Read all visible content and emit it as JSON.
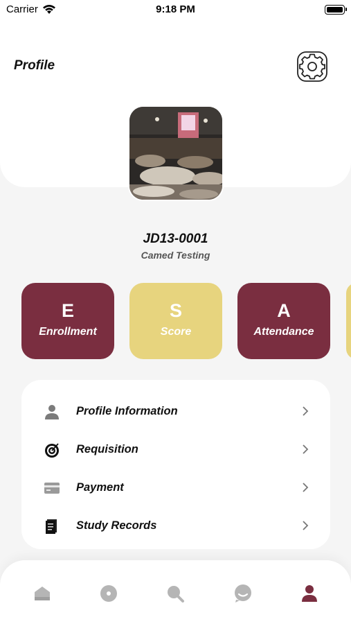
{
  "status_bar": {
    "carrier": "Carrier",
    "time": "9:18 PM"
  },
  "header": {
    "title": "Profile",
    "settings_icon": "gear-icon"
  },
  "profile": {
    "id": "JD13-0001",
    "name": "Camed Testing"
  },
  "tiles": [
    {
      "letter": "E",
      "label": "Enrollment",
      "color": "#7a2e40"
    },
    {
      "letter": "S",
      "label": "Score",
      "color": "#e7d47e"
    },
    {
      "letter": "A",
      "label": "Attendance",
      "color": "#7a2e40"
    }
  ],
  "menu": [
    {
      "label": "Profile Information",
      "icon": "person-icon"
    },
    {
      "label": "Requisition",
      "icon": "target-icon"
    },
    {
      "label": "Payment",
      "icon": "card-icon"
    },
    {
      "label": "Study Records",
      "icon": "document-icon"
    }
  ],
  "tab_bar": [
    {
      "icon": "home-icon",
      "active": false
    },
    {
      "icon": "compass-icon",
      "active": false
    },
    {
      "icon": "search-icon",
      "active": false
    },
    {
      "icon": "chat-icon",
      "active": false
    },
    {
      "icon": "profile-icon",
      "active": true
    }
  ],
  "colors": {
    "accent": "#7a2e40",
    "gold": "#e7d47e",
    "inactive_icon": "#b5b5b5"
  }
}
